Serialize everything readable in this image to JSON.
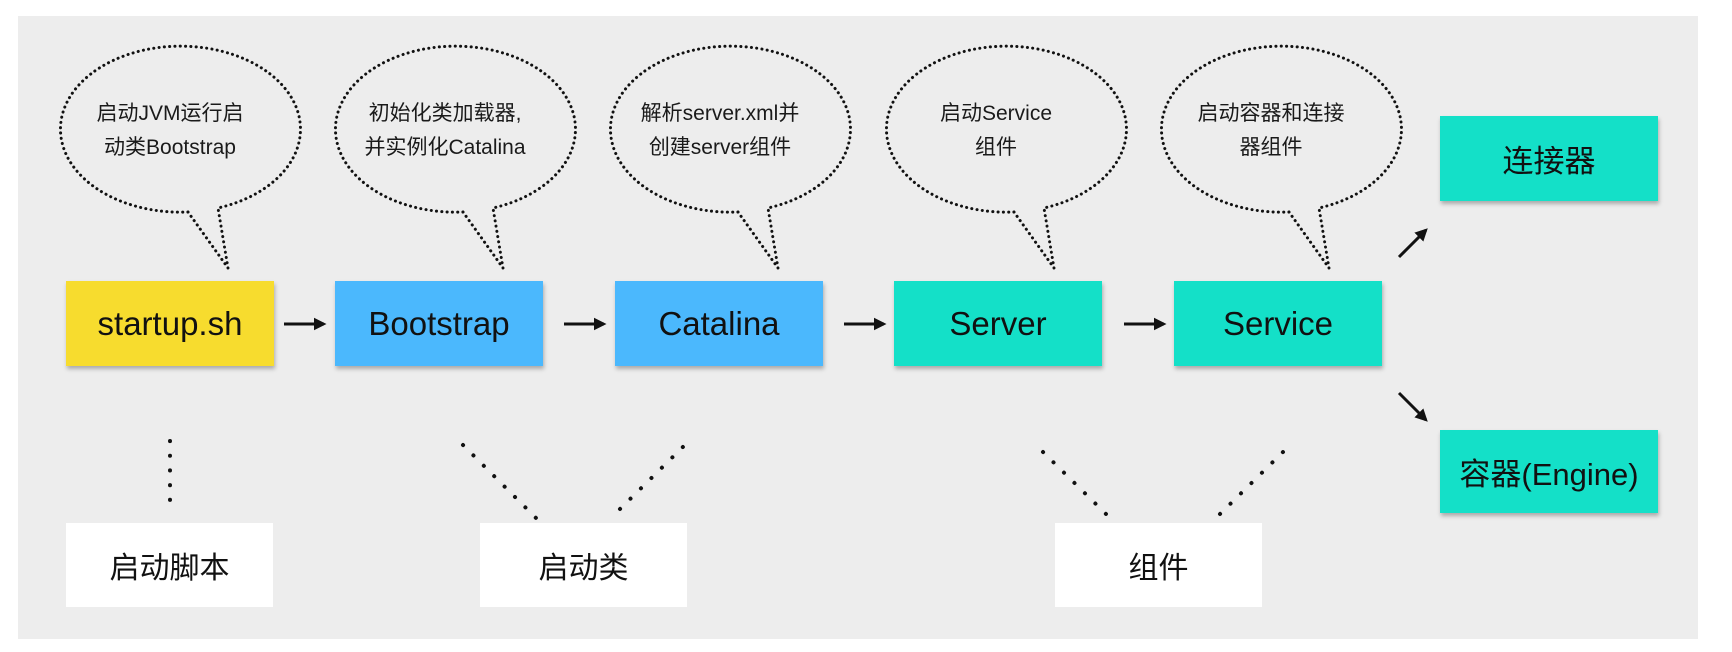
{
  "colors": {
    "panel": "#ededed",
    "script": "#f7dc2e",
    "bootstrap_class": "#4bb8fd",
    "component": "#14e0c8",
    "label_bg": "#ffffff",
    "ink": "#111111"
  },
  "steps": [
    {
      "id": "startup",
      "label": "startup.sh",
      "kind": "script"
    },
    {
      "id": "bootstrap",
      "label": "Bootstrap",
      "kind": "bootstrap_class"
    },
    {
      "id": "catalina",
      "label": "Catalina",
      "kind": "bootstrap_class"
    },
    {
      "id": "server",
      "label": "Server",
      "kind": "component"
    },
    {
      "id": "service",
      "label": "Service",
      "kind": "component"
    }
  ],
  "branches": [
    {
      "id": "connector",
      "label": "连接器"
    },
    {
      "id": "engine",
      "label": "容器(Engine)"
    }
  ],
  "bubbles": [
    {
      "lines": [
        "启动JVM运行启",
        "动类Bootstrap"
      ]
    },
    {
      "lines": [
        "初始化类加载器,",
        "并实例化Catalina"
      ]
    },
    {
      "lines": [
        "解析server.xml并",
        "创建server组件"
      ]
    },
    {
      "lines": [
        "启动Service",
        "组件"
      ]
    },
    {
      "lines": [
        "启动容器和连接",
        "器组件"
      ]
    }
  ],
  "groups": [
    {
      "id": "script-group",
      "label": "启动脚本"
    },
    {
      "id": "class-group",
      "label": "启动类"
    },
    {
      "id": "component-group",
      "label": "组件"
    }
  ]
}
